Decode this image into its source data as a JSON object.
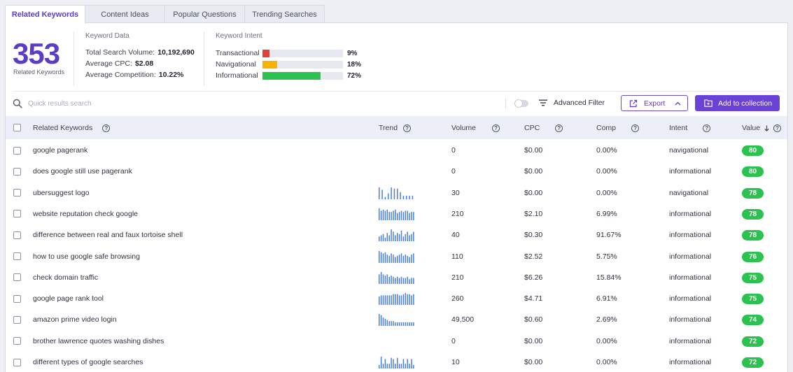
{
  "tabs": [
    "Related Keywords",
    "Content Ideas",
    "Popular Questions",
    "Trending Searches"
  ],
  "summary": {
    "count": "353",
    "count_label": "Related Keywords",
    "keyword_data": {
      "title": "Keyword Data",
      "total_volume_label": "Total Search Volume:",
      "total_volume": "10,192,690",
      "avg_cpc_label": "Average CPC:",
      "avg_cpc": "$2.08",
      "avg_comp_label": "Average Competition:",
      "avg_comp": "10.22%"
    },
    "keyword_intent": {
      "title": "Keyword Intent",
      "rows": [
        {
          "label": "Transactional",
          "pct": "9%",
          "value": 9,
          "color": "#e2403a"
        },
        {
          "label": "Navigational",
          "pct": "18%",
          "value": 18,
          "color": "#f6b400"
        },
        {
          "label": "Informational",
          "pct": "72%",
          "value": 72,
          "color": "#2bc24f"
        }
      ]
    }
  },
  "toolbar": {
    "search_placeholder": "Quick results search",
    "advanced_filter": "Advanced Filter",
    "export": "Export",
    "add_to_collection": "Add to collection"
  },
  "table": {
    "headers": {
      "keyword": "Related Keywords",
      "trend": "Trend",
      "volume": "Volume",
      "cpc": "CPC",
      "comp": "Comp",
      "intent": "Intent",
      "value": "Value"
    },
    "rows": [
      {
        "keyword": "google pagerank",
        "volume": "0",
        "cpc": "$0.00",
        "comp": "0.00%",
        "intent": "navigational",
        "value": "80",
        "trend": []
      },
      {
        "keyword": "does google still use pagerank",
        "volume": "0",
        "cpc": "$0.00",
        "comp": "0.00%",
        "intent": "informational",
        "value": "80",
        "trend": []
      },
      {
        "keyword": "ubersuggest logo",
        "volume": "30",
        "cpc": "$0.00",
        "comp": "0.00%",
        "intent": "navigational",
        "value": "78",
        "trend": [
          1,
          0.8,
          0.2,
          0.5,
          1,
          0.9,
          0.9,
          0.6,
          0.3,
          0.3,
          0.3,
          0.3
        ]
      },
      {
        "keyword": "website reputation check google",
        "volume": "210",
        "cpc": "$2.10",
        "comp": "6.99%",
        "intent": "informational",
        "value": "78",
        "trend": [
          1,
          0.8,
          0.9,
          0.8,
          0.9,
          0.7,
          0.7,
          0.8,
          0.9,
          0.6,
          0.7,
          0.8,
          0.7,
          0.8,
          0.8,
          0.6,
          0.7,
          0.7
        ]
      },
      {
        "keyword": "difference between real and faux tortoise shell",
        "volume": "40",
        "cpc": "$0.30",
        "comp": "91.67%",
        "intent": "informational",
        "value": "78",
        "trend": [
          0.4,
          0.5,
          0.6,
          0.3,
          0.7,
          0.5,
          1,
          0.8,
          0.5,
          0.7,
          0.6,
          0.9,
          0.4,
          0.6,
          0.8,
          0.5,
          0.6,
          0.8
        ]
      },
      {
        "keyword": "how to use google safe browsing",
        "volume": "110",
        "cpc": "$2.52",
        "comp": "5.75%",
        "intent": "informational",
        "value": "76",
        "trend": [
          1,
          0.9,
          0.8,
          0.9,
          0.7,
          0.6,
          0.8,
          0.7,
          0.5,
          0.6,
          0.7,
          0.8,
          0.6,
          0.7,
          0.6,
          0.5,
          0.7,
          0.8
        ]
      },
      {
        "keyword": "check domain traffic",
        "volume": "210",
        "cpc": "$6.26",
        "comp": "15.84%",
        "intent": "informational",
        "value": "75",
        "trend": [
          0.8,
          1,
          0.8,
          0.7,
          0.8,
          0.6,
          0.7,
          0.6,
          0.5,
          0.6,
          0.5,
          0.6,
          0.5,
          0.5,
          0.6,
          0.4,
          0.5,
          0.5
        ]
      },
      {
        "keyword": "google page rank tool",
        "volume": "260",
        "cpc": "$4.71",
        "comp": "6.91%",
        "intent": "informational",
        "value": "75",
        "trend": [
          0.7,
          0.8,
          0.8,
          0.8,
          0.8,
          0.8,
          0.8,
          0.9,
          0.9,
          0.9,
          0.8,
          0.8,
          0.9,
          1,
          0.9,
          0.9,
          0.8,
          0.9
        ]
      },
      {
        "keyword": "amazon prime video login",
        "volume": "49,500",
        "cpc": "$0.60",
        "comp": "2.69%",
        "intent": "informational",
        "value": "74",
        "trend": [
          1,
          0.9,
          0.7,
          0.6,
          0.5,
          0.4,
          0.4,
          0.4,
          0.3,
          0.3,
          0.3,
          0.3,
          0.3,
          0.3,
          0.3,
          0.3,
          0.3,
          0.3
        ]
      },
      {
        "keyword": "brother lawrence quotes washing dishes",
        "volume": "0",
        "cpc": "$0.00",
        "comp": "0.00%",
        "intent": "informational",
        "value": "72",
        "trend": []
      },
      {
        "keyword": "different types of google searches",
        "volume": "10",
        "cpc": "$0.00",
        "comp": "0.00%",
        "intent": "informational",
        "value": "72",
        "trend": [
          0.3,
          1,
          0.4,
          0.8,
          0.4,
          0.4,
          0.9,
          0.8,
          0.4,
          0.9,
          0.4,
          0.4,
          0.8,
          0.4,
          0.8,
          0.4,
          0.8,
          0.3
        ]
      }
    ]
  },
  "colors": {
    "accent": "#5b3cc4",
    "button": "#6a42d6",
    "badge": "#2bc24f",
    "trend_bar": "#4a7fe0"
  }
}
